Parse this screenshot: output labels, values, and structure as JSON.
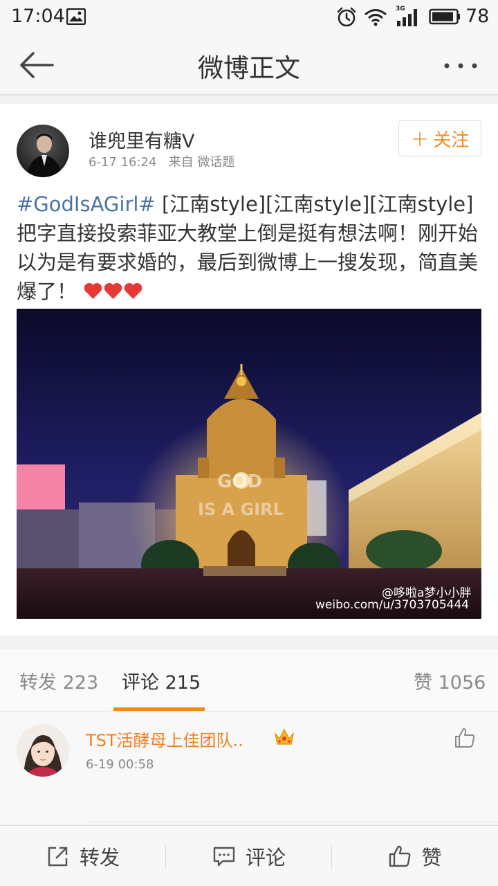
{
  "status_bar": {
    "time": "17:04",
    "battery": "78",
    "network": "3G"
  },
  "nav": {
    "title": "微博正文"
  },
  "post": {
    "author": "谁兜里有糖V",
    "date": "6-17 16:24",
    "source_prefix": "来自",
    "source": "微话题",
    "follow_label": "关注",
    "hashtag": "#GodIsAGirl#",
    "text": " [江南style][江南style][江南style]把字直接投索菲亚大教堂上倒是挺有想法啊！刚开始以为是有要求婚的，最后到微博上一搜发现，简直美爆了！",
    "image": {
      "watermark_handle": "@哆啦a梦小小胖",
      "watermark_url": "weibo.com/u/3703705444",
      "projected_text_1": "GOD",
      "projected_text_2": "IS A GIRL"
    }
  },
  "tabs": {
    "repost": {
      "label": "转发",
      "count": "223"
    },
    "comment": {
      "label": "评论",
      "count": "215"
    },
    "like": {
      "label": "赞",
      "count": "1056"
    }
  },
  "comment": {
    "user": "TST活酵母上佳团队..",
    "time": "6-19 00:58"
  },
  "bottom_bar": {
    "repost": "转发",
    "comment": "评论",
    "like": "赞"
  },
  "icons": [
    "back-arrow-icon",
    "more-icon",
    "image-icon",
    "alarm-icon",
    "wifi-icon",
    "signal-icon",
    "battery-icon",
    "heart-icon",
    "crown-icon",
    "thumbs-up-icon",
    "share-icon",
    "comment-icon"
  ],
  "colors": {
    "accent": "#f18a1d",
    "hashtag": "#4b73a6",
    "heart": "#e53935"
  }
}
